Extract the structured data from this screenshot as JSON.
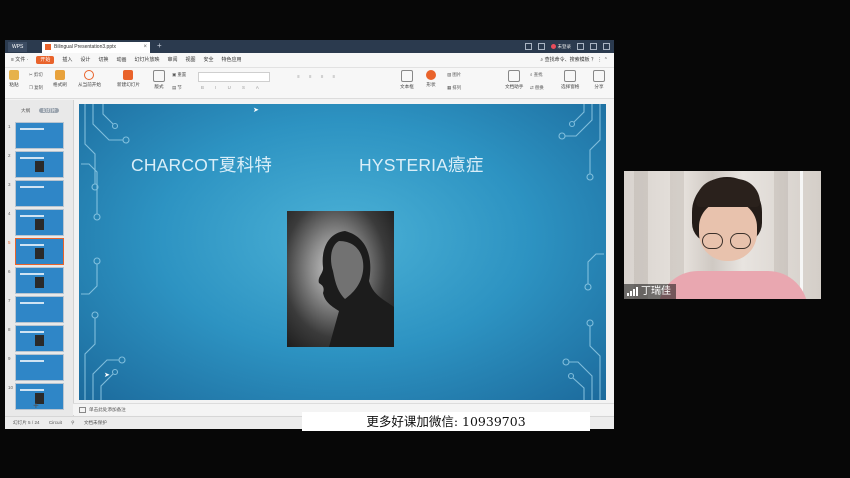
{
  "window": {
    "app_tab": "WPS",
    "doc_tab": "Bilingual Presentation3.pptx",
    "login_text": "未登录"
  },
  "menubar": {
    "items": [
      "≡ 文件 ·",
      "开始",
      "插入",
      "设计",
      "切换",
      "动画",
      "幻灯片放映",
      "审阅",
      "视图",
      "安全",
      "特色应用"
    ],
    "active_index": 1,
    "search_text": "查找命令、搜索模板"
  },
  "ribbon": {
    "paste": "粘贴",
    "cut": "剪切",
    "copy": "复制",
    "format_painter": "格式刷",
    "play_from_current": "从当前开始",
    "new_slide": "新建幻灯片",
    "layout": "版式",
    "reset": "重置",
    "section": "节",
    "textbox": "文本框",
    "shape": "形状",
    "picture": "图片",
    "arrange": "排列",
    "find": "查找",
    "replace": "替换",
    "select": "选择",
    "doc_helper": "文档助手",
    "select_pane": "选择窗格",
    "share": "分享"
  },
  "sidebar": {
    "tab_outline": "大纲",
    "tab_slides": "幻灯片",
    "slide_numbers": [
      "1",
      "2",
      "3",
      "4",
      "5",
      "6",
      "7",
      "8",
      "9",
      "10"
    ],
    "current_index": 4,
    "add_label": "+"
  },
  "slide": {
    "title_left": "CHARCOT夏科特",
    "title_right": "HYSTERIA癔症"
  },
  "notes": {
    "placeholder": "单击此处添加备注"
  },
  "statusbar": {
    "slide_counter": "幻灯片 5 / 24",
    "theme": "Circuit",
    "protection": "文档未保护"
  },
  "watermark": {
    "text": "更多好课加微信: 10939703"
  },
  "webcam": {
    "name": "丁瑞佳"
  },
  "colors": {
    "accent": "#e9632b",
    "slide_blue": "#2d93c2",
    "titlebar": "#2b3a4e"
  }
}
